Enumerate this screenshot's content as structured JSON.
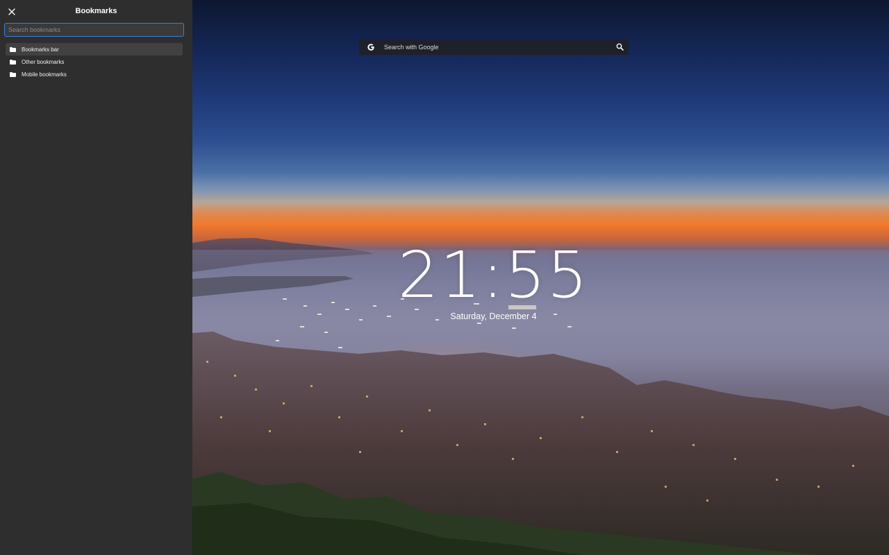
{
  "sidebar": {
    "title": "Bookmarks",
    "search_placeholder": "Search bookmarks",
    "items": [
      {
        "label": "Bookmarks bar",
        "icon": "folder-icon",
        "active": true
      },
      {
        "label": "Other bookmarks",
        "icon": "folder-icon",
        "active": false
      },
      {
        "label": "Mobile bookmarks",
        "icon": "folder-icon",
        "active": false
      }
    ]
  },
  "search": {
    "placeholder": "Search with Google",
    "left_icon": "google-icon",
    "right_icon": "search-icon"
  },
  "clock": {
    "time": "21:55",
    "date": "Saturday, December 4"
  },
  "colors": {
    "sidebar_bg": "#2e2e2e",
    "item_active_bg": "#414141",
    "search_focus_border": "#3d7fd6",
    "search_bar_bg": "#1e2129"
  }
}
